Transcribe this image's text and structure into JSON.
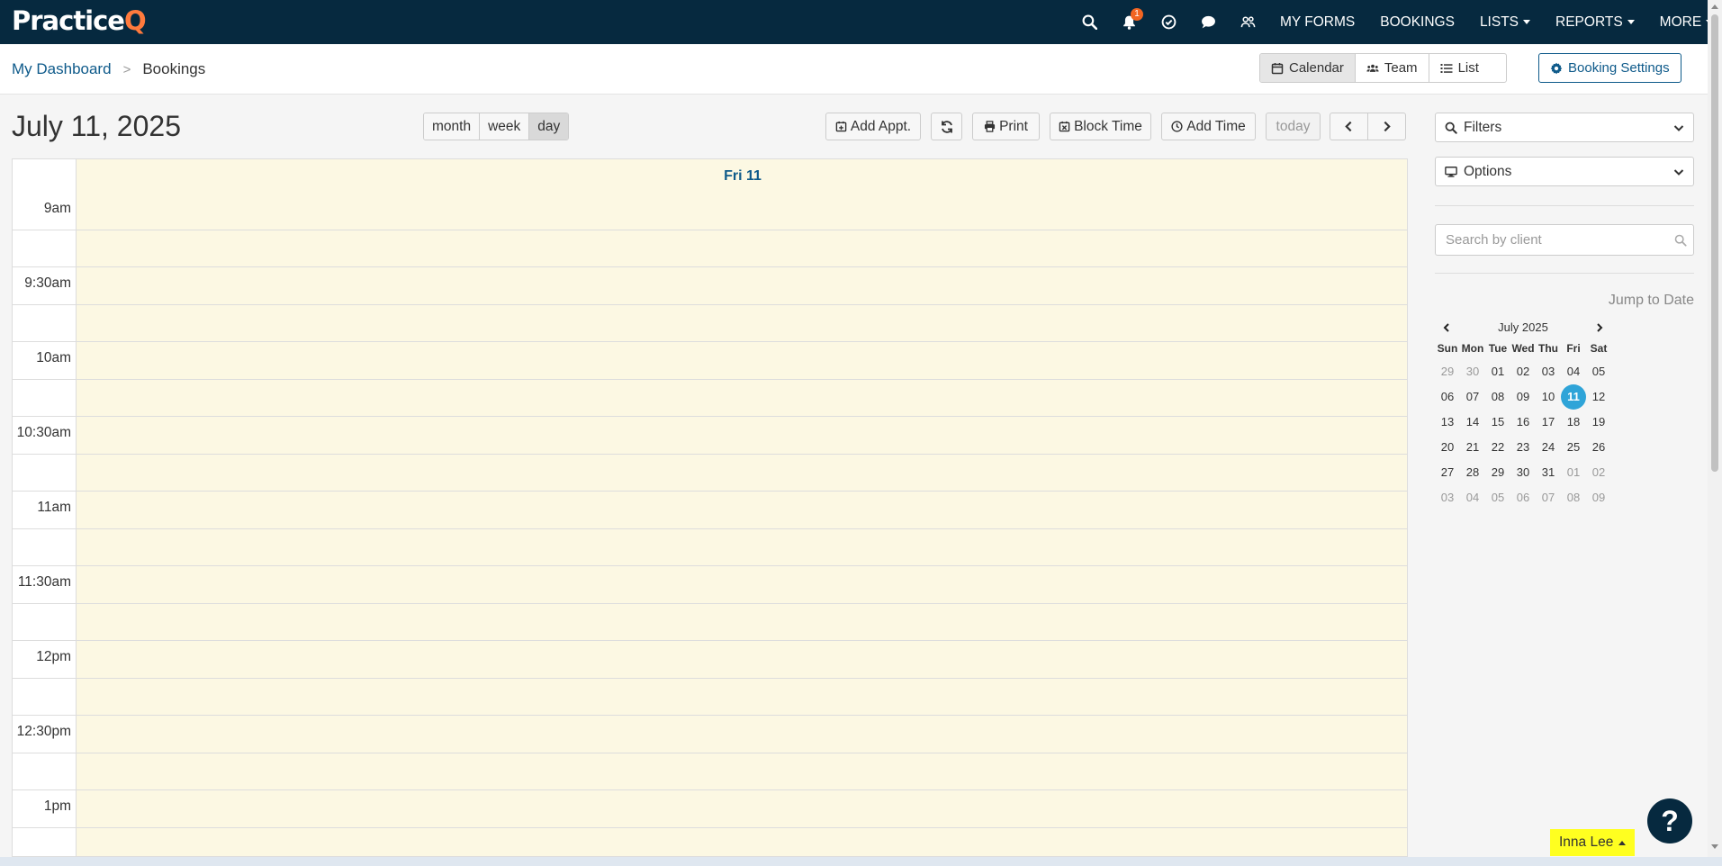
{
  "app": {
    "logo_main": "Practice",
    "logo_accent": "Q"
  },
  "topnav": {
    "notification_count": "1",
    "links": [
      "MY FORMS",
      "BOOKINGS",
      "LISTS",
      "REPORTS",
      "MORE"
    ]
  },
  "breadcrumb": {
    "home": "My Dashboard",
    "separator": ">",
    "current": "Bookings"
  },
  "view_toggle": {
    "calendar": "Calendar",
    "team": "Team",
    "list": "List"
  },
  "booking_settings": "Booking Settings",
  "calendar": {
    "date_title": "July 11, 2025",
    "views": {
      "month": "month",
      "week": "week",
      "day": "day"
    },
    "toolbar": {
      "add_appt": "Add Appt.",
      "print": "Print",
      "block_time": "Block Time",
      "add_time": "Add Time",
      "today": "today"
    },
    "day_header": "Fri 11",
    "times": [
      "9am",
      "",
      "9:30am",
      "",
      "10am",
      "",
      "10:30am",
      "",
      "11am",
      "",
      "11:30am",
      "",
      "12pm",
      "",
      "12:30pm",
      "",
      "1pm",
      ""
    ]
  },
  "panel": {
    "filters": "Filters",
    "options": "Options",
    "search_placeholder": "Search by client",
    "jump_title": "Jump to Date",
    "mini_cal": {
      "month_label": "July 2025",
      "dows": [
        "Sun",
        "Mon",
        "Tue",
        "Wed",
        "Thu",
        "Fri",
        "Sat"
      ],
      "weeks": [
        [
          "29",
          "30",
          "01",
          "02",
          "03",
          "04",
          "05"
        ],
        [
          "06",
          "07",
          "08",
          "09",
          "10",
          "11",
          "12"
        ],
        [
          "13",
          "14",
          "15",
          "16",
          "17",
          "18",
          "19"
        ],
        [
          "20",
          "21",
          "22",
          "23",
          "24",
          "25",
          "26"
        ],
        [
          "27",
          "28",
          "29",
          "30",
          "31",
          "01",
          "02"
        ],
        [
          "03",
          "04",
          "05",
          "06",
          "07",
          "08",
          "09"
        ]
      ],
      "other_month": [
        [
          0,
          0
        ],
        [
          0,
          1
        ],
        [
          4,
          5
        ],
        [
          4,
          6
        ],
        [
          5,
          0
        ],
        [
          5,
          1
        ],
        [
          5,
          2
        ],
        [
          5,
          3
        ],
        [
          5,
          4
        ],
        [
          5,
          5
        ],
        [
          5,
          6
        ]
      ],
      "selected": [
        1,
        5
      ]
    }
  },
  "help": "?",
  "user": "Inna Lee",
  "colors": {
    "nav_bg": "#06293f",
    "accent": "#0e5a8a",
    "logo_q": "#ff7a3d",
    "badge": "#f26522",
    "selected_day": "#2fa4d8",
    "cal_bg": "#fcf8e3",
    "user_tag": "#ffff20"
  }
}
